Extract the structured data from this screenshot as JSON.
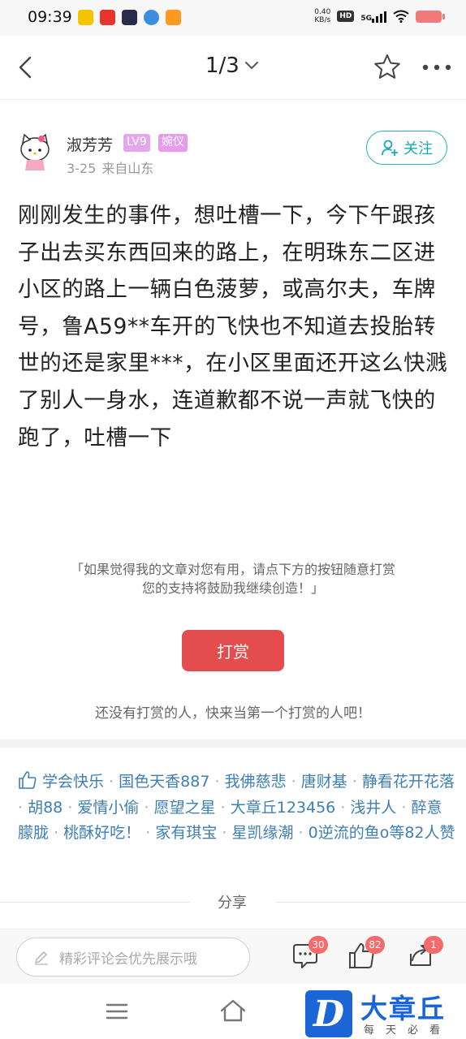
{
  "status_bar": {
    "time": "09:39",
    "net_speed_value": "0.40",
    "net_speed_unit": "KB/s",
    "hd": "HD",
    "signal": "5G",
    "app_icons": [
      "app-icon-yellow",
      "app-icon-red",
      "app-icon-dark",
      "app-icon-blue",
      "app-icon-orange"
    ]
  },
  "nav": {
    "pager": "1/3",
    "icons": [
      "back-icon",
      "chevron-down-icon",
      "star-icon",
      "more-icon"
    ]
  },
  "author": {
    "name": "淑芳芳",
    "level": "LV9",
    "title_badge": "婉仪",
    "date": "3-25",
    "source": "来自山东",
    "follow_label": "关注"
  },
  "post": {
    "body": "刚刚发生的事件，想吐槽一下，今下午跟孩子出去买东西回来的路上，在明珠东二区进小区的路上一辆白色菠萝，或高尔夫，车牌号，鲁A59**车开的飞快也不知道去投胎转世的还是家里***，在小区里面还开这么快溅了别人一身水，连道歉都不说一声就飞快的跑了，吐槽一下"
  },
  "reward": {
    "prompt_line1": "「如果觉得我的文章对您有用，请点下方的按钮随意打赏",
    "prompt_line2": "您的支持将鼓励我继续创造！」",
    "button_label": "打赏",
    "empty_text": "还没有打赏的人，快来当第一个打赏的人吧！"
  },
  "likes": {
    "users": [
      "学会快乐",
      "国色天香887",
      "我佛慈悲",
      "唐财基",
      "静看花开花落",
      "胡88",
      "爱情小偷",
      "愿望之星",
      "大章丘123456",
      "浅井人",
      "醉意朦胧",
      "桃酥好吃！",
      "家有琪宝",
      "星凯缘潮"
    ],
    "last_user": "0逆流的鱼o",
    "summary_suffix": "等82人赞"
  },
  "share": {
    "label": "分享"
  },
  "bottom_bar": {
    "comment_placeholder": "精彩评论会优先展示哦",
    "comment_count": "30",
    "like_count": "82",
    "share_count": "1"
  },
  "watermark": {
    "letter": "D",
    "title": "大章丘",
    "subtitle": "每天必看"
  },
  "colors": {
    "accent": "#1aa9b6",
    "reward": "#e44d4d",
    "link": "#3f7fb3",
    "badge": "#f56a6a",
    "brand": "#1b66d6"
  }
}
